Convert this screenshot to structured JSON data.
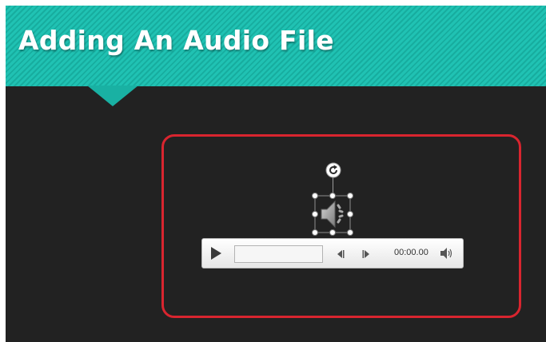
{
  "slide": {
    "title": "Adding An Audio File",
    "banner_color": "#1fbfb0",
    "background_color": "#222222",
    "highlight_color": "#d9252f"
  },
  "audio_object": {
    "icon": "speaker-icon",
    "selected": true
  },
  "player": {
    "time": "00:00.00",
    "play_icon": "play-icon",
    "back_icon": "skip-back-icon",
    "forward_icon": "skip-forward-icon",
    "volume_icon": "volume-icon",
    "progress": 0
  }
}
